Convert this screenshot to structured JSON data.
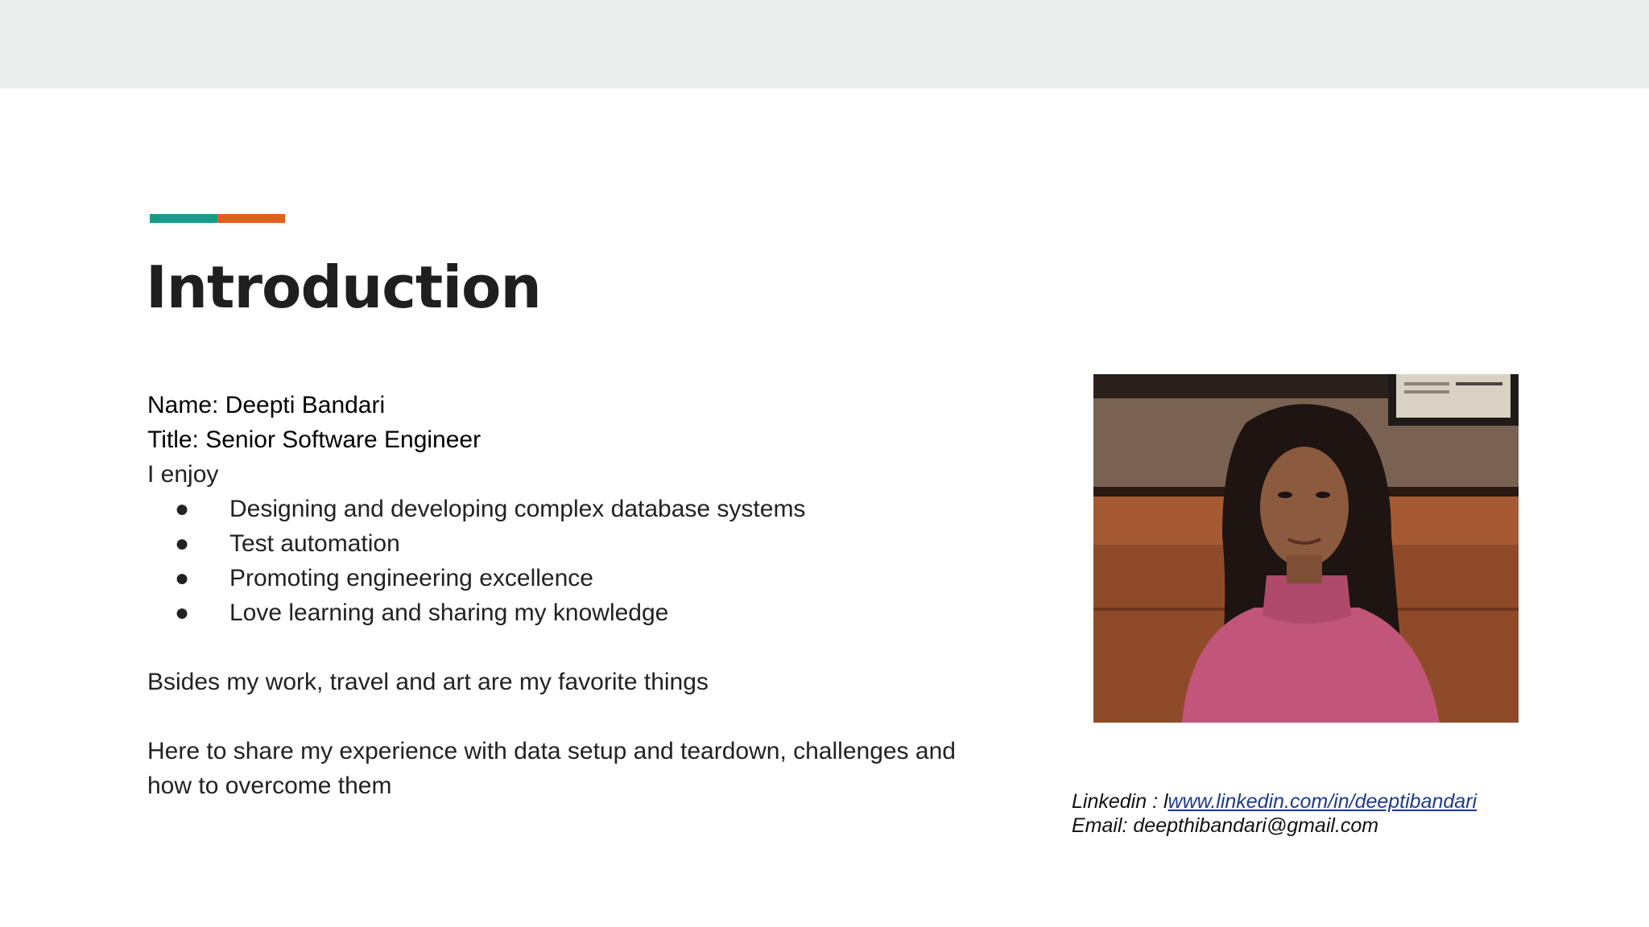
{
  "slide": {
    "title": "Introduction",
    "name_line": "Name: Deepti Bandari",
    "title_line": "Title: Senior Software Engineer",
    "enjoy_intro": "I enjoy",
    "bullet_glyph": "●",
    "bullets": [
      "Designing and developing complex database systems",
      "Test automation",
      "Promoting engineering excellence",
      "Love learning and sharing my knowledge"
    ],
    "besides": "Bsides my work, travel and art are my favorite things",
    "purpose_line1": "Here to share my experience with data setup and teardown, challenges and",
    "purpose_line2": "how to overcome them",
    "contact": {
      "linkedin_label": "Linkedin : l",
      "linkedin_url": "www.linkedin.com/in/deeptibandari",
      "email_line": "Email: deepthibandari@gmail.com"
    }
  },
  "colors": {
    "top_band": "#e9eeed",
    "accent_teal": "#1a9b8a",
    "accent_orange": "#e0601e",
    "link": "#1c3a8f"
  }
}
